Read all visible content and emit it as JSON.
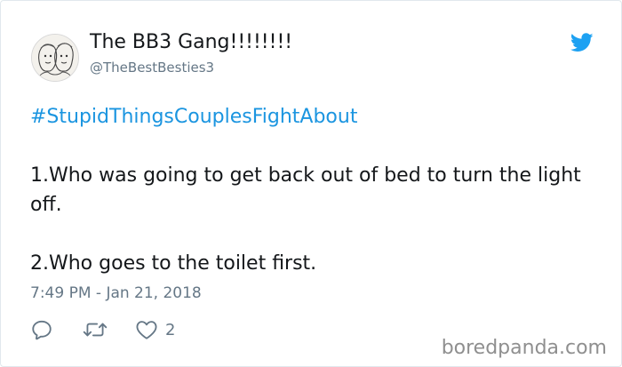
{
  "tweet": {
    "display_name": "The BB3 Gang!!!!!!!!",
    "handle": "@TheBestBesties3",
    "hashtag": "#StupidThingsCouplesFightAbout",
    "lines": [
      "1.Who was going to get back out of bed to turn the light off.",
      "2.Who goes to the toilet first."
    ],
    "timestamp": "7:49 PM - Jan 21, 2018",
    "like_count": "2"
  },
  "icons": {
    "brand": "twitter-bird-icon",
    "reply": "reply-icon",
    "retweet": "retweet-icon",
    "like": "heart-icon"
  },
  "watermark": "boredpanda.com",
  "colors": {
    "link": "#1b95e0",
    "muted": "#657786",
    "text": "#14171a",
    "watermark": "#8f8f8f"
  }
}
